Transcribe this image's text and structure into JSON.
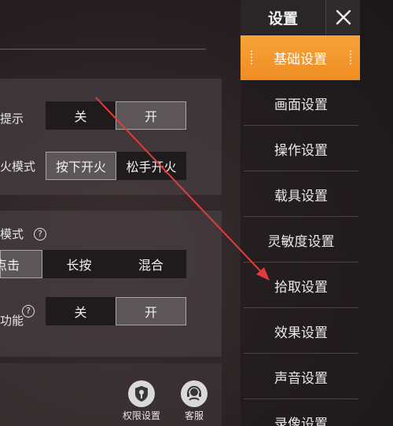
{
  "header": {
    "title": "设置"
  },
  "menu": {
    "items": [
      {
        "label": "基础设置",
        "active": true
      },
      {
        "label": "画面设置"
      },
      {
        "label": "操作设置"
      },
      {
        "label": "载具设置"
      },
      {
        "label": "灵敏度设置"
      },
      {
        "label": "拾取设置"
      },
      {
        "label": "效果设置"
      },
      {
        "label": "声音设置"
      },
      {
        "label": "录像设置"
      }
    ]
  },
  "settings": {
    "row1": {
      "label": "提示",
      "options": [
        "关",
        "开"
      ],
      "selected": "开"
    },
    "row2": {
      "label": "火模式",
      "options": [
        "按下开火",
        "松手开火"
      ],
      "selected": "按下开火"
    },
    "row3": {
      "label": "模式"
    },
    "row3_opts": {
      "options": [
        "点击",
        "长按",
        "混合"
      ],
      "selected": "点击"
    },
    "row4": {
      "label": "功能",
      "options": [
        "关",
        "开"
      ],
      "selected": "开"
    }
  },
  "footer": {
    "permission_label": "权限设置",
    "support_label": "客服"
  },
  "colors": {
    "accent": "#f0962a",
    "annotation_arrow": "#e23b3b"
  }
}
